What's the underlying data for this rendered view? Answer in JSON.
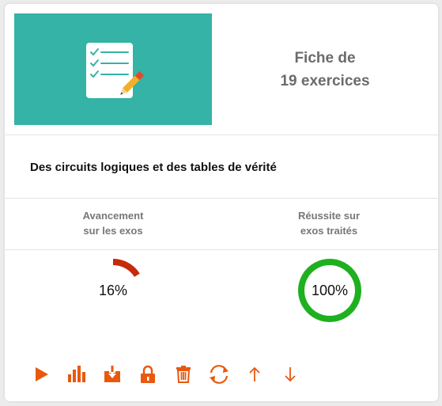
{
  "card": {
    "count_line1": "Fiche de",
    "count_line2": "19 exercices",
    "title": "Des circuits logiques et des tables de vérité"
  },
  "stats": {
    "progress": {
      "label_line1": "Avancement",
      "label_line2": "sur les exos",
      "value": 16,
      "display": "16%",
      "color": "#c62a09"
    },
    "success": {
      "label_line1": "Réussite sur",
      "label_line2": "exos traités",
      "value": 100,
      "display": "100%",
      "color": "#1fb01f"
    }
  },
  "colors": {
    "thumbnail_bg": "#34b3a6",
    "action_icons": "#e8590f"
  },
  "actions": [
    {
      "icon": "play-icon"
    },
    {
      "icon": "bar-chart-icon"
    },
    {
      "icon": "download-icon"
    },
    {
      "icon": "lock-icon"
    },
    {
      "icon": "trash-icon"
    },
    {
      "icon": "refresh-icon"
    },
    {
      "icon": "arrow-up-icon"
    },
    {
      "icon": "arrow-down-icon"
    }
  ]
}
